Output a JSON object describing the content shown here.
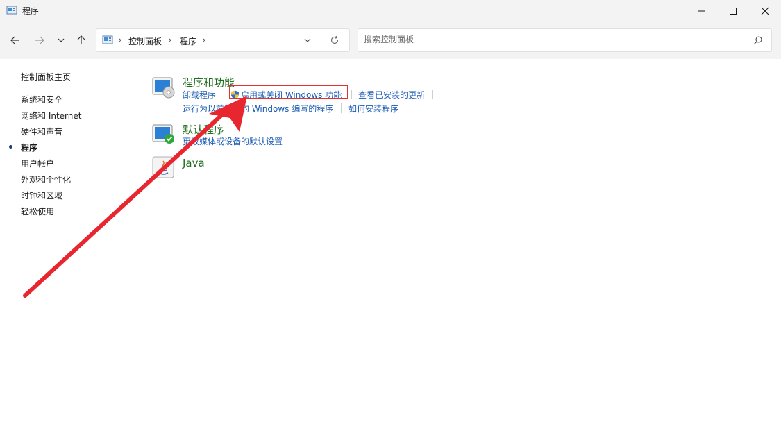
{
  "window": {
    "title": "程序",
    "controls": {
      "minimize": "minimize-icon",
      "maximize": "maximize-icon",
      "close": "close-icon"
    }
  },
  "address_bar": {
    "breadcrumbs": [
      "控制面板",
      "程序"
    ],
    "search_placeholder": "搜索控制面板"
  },
  "sidebar": {
    "home": "控制面板主页",
    "items": [
      {
        "label": "系统和安全"
      },
      {
        "label": "网络和 Internet"
      },
      {
        "label": "硬件和声音"
      },
      {
        "label": "程序",
        "current": true
      },
      {
        "label": "用户帐户"
      },
      {
        "label": "外观和个性化"
      },
      {
        "label": "时钟和区域"
      },
      {
        "label": "轻松使用"
      }
    ]
  },
  "categories": [
    {
      "title": "程序和功能",
      "links": [
        "卸载程序",
        "启用或关闭 Windows 功能",
        "查看已安装的更新",
        "运行为以前版本的 Windows 编写的程序",
        "如何安装程序"
      ]
    },
    {
      "title": "默认程序",
      "links": [
        "更改媒体或设备的默认设置"
      ]
    },
    {
      "title": "Java",
      "links": []
    }
  ],
  "annotation": {
    "color": "#e53030"
  }
}
